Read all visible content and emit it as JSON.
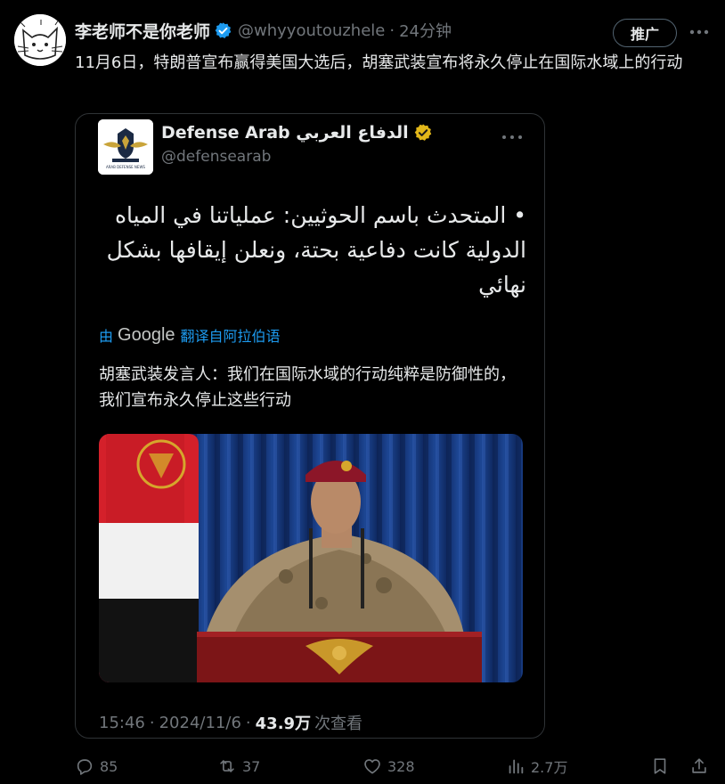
{
  "post": {
    "display_name": "李老师不是你老师",
    "handle": "@whyyoutouzhele",
    "separator": "·",
    "time": "24分钟",
    "promote_label": "推广",
    "text": "11月6日，特朗普宣布赢得美国大选后，胡塞武装宣布将永久停止在国际水域上的行动"
  },
  "quote": {
    "avatar_caption": "ARAB DEFENSE NEWS",
    "display_name": "Defense Arab الدفاع العربي",
    "handle": "@defensearab",
    "arabic_text": "• المتحدث باسم الحوثيين: عملياتنا في المياه الدولية كانت دفاعية بحتة، ونعلن إيقافها بشكل نهائي",
    "translate": {
      "by": "由",
      "google": "Google",
      "link": "翻译自阿拉伯语"
    },
    "translated_text": "胡塞武装发言人：我们在国际水域的行动纯粹是防御性的，我们宣布永久停止这些行动",
    "meta": {
      "time": "15:46",
      "sep1": "·",
      "date": "2024/11/6",
      "sep2": "·",
      "views": "43.9万",
      "views_label": "次查看"
    }
  },
  "actions": {
    "replies": "85",
    "reposts": "37",
    "likes": "328",
    "views": "2.7万"
  },
  "colors": {
    "background": "#000000",
    "text": "#e7e9ea",
    "secondary": "#71767b",
    "accent": "#1d9bf0",
    "border": "#2f3336",
    "gold_badge": "#e2b719"
  },
  "icons": {
    "verified": "verified-badge-icon",
    "gold_verified": "gold-verified-badge-icon",
    "more": "more-horizontal-icon",
    "reply": "reply-icon",
    "repost": "repost-icon",
    "like": "heart-icon",
    "views": "analytics-icon",
    "bookmark": "bookmark-icon",
    "share": "share-icon"
  }
}
